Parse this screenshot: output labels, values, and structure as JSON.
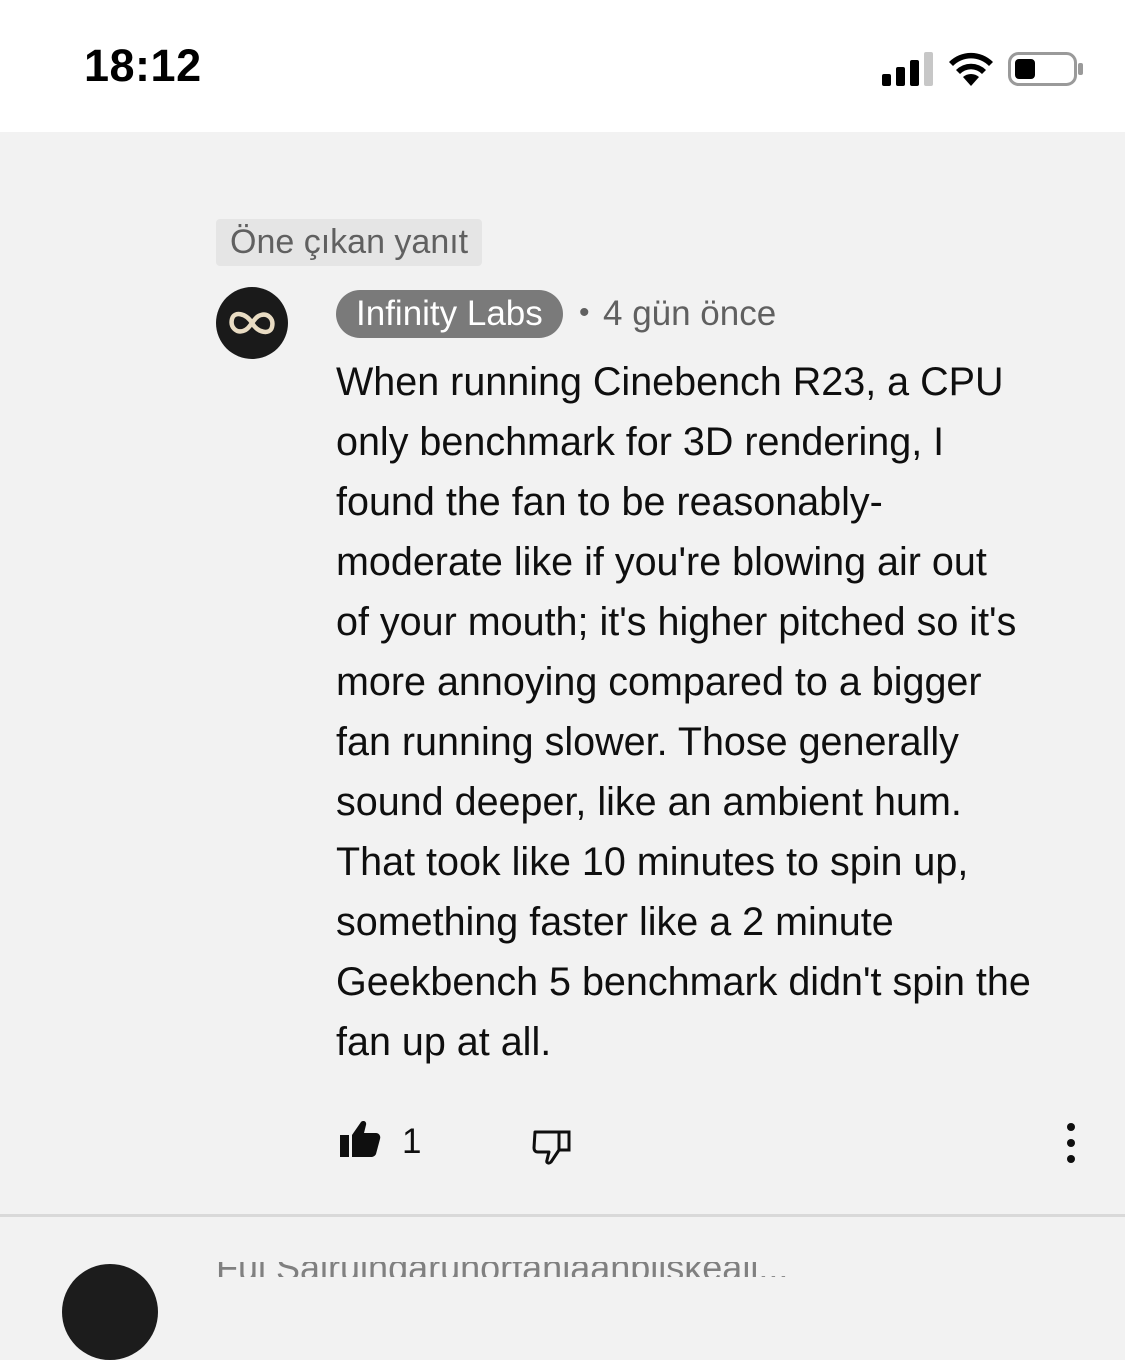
{
  "status_bar": {
    "time": "18:12",
    "icons": [
      "cellular-signal-icon",
      "wifi-icon",
      "battery-icon"
    ]
  },
  "comment": {
    "pinned_label": "Öne çıkan yanıt",
    "avatar_icon": "infinity-icon",
    "author": "Infinity Labs",
    "separator": "•",
    "timestamp": "4 gün önce",
    "body_lines": [
      "When running Cinebench R23, a CPU",
      "only benchmark for 3D rendering, I",
      "found the fan to be reasonably-",
      "moderate like if you're blowing air out",
      "of your mouth; it's higher pitched so it's",
      "more annoying compared to a bigger",
      "fan running slower. Those generally",
      "sound deeper, like an ambient hum.",
      "That took like 10 minutes to spin up,",
      "something faster like a 2 minute",
      "Geekbench 5 benchmark didn't spin the",
      "fan up at all."
    ],
    "actions": {
      "like_icon": "thumbs-up-filled-icon",
      "like_count": "1",
      "dislike_icon": "thumbs-down-outline-icon",
      "more_icon": "more-vertical-icon"
    }
  },
  "next_comment": {
    "partial_text": "Fui Sairuindarunorfanlaanbiiskeali..."
  },
  "colors": {
    "background": "#f2f2f2",
    "status_bar": "#ffffff",
    "author_chip": "#7a7a7a",
    "secondary_text": "#606060"
  }
}
